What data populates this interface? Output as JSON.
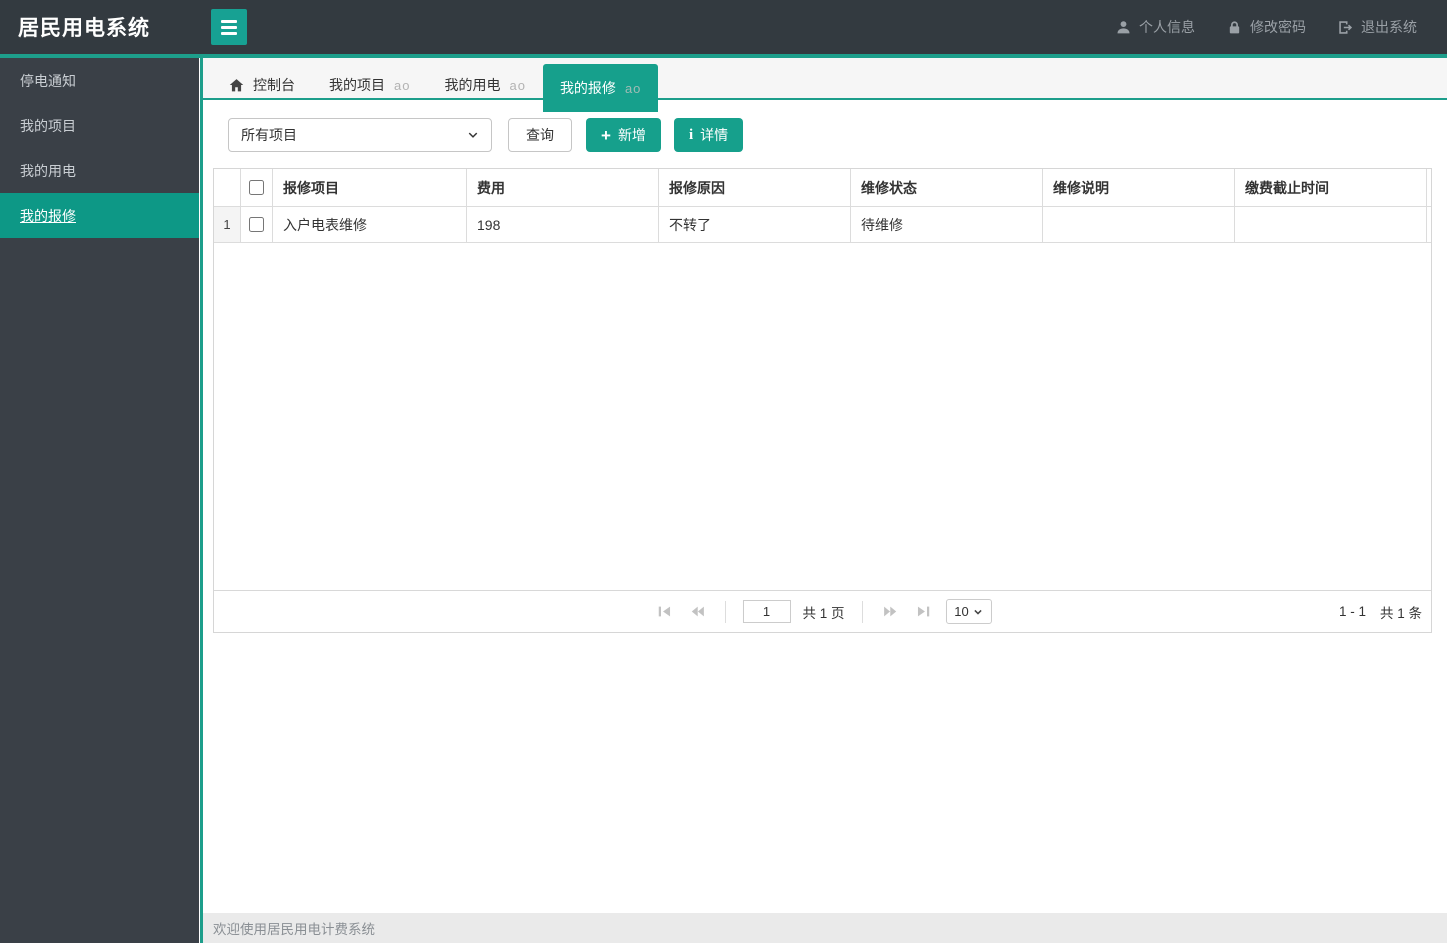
{
  "colors": {
    "accent": "#16a08c",
    "accent_line": "#1d9e8b",
    "header_bg": "#333a40",
    "sidebar_bg": "#3a4047",
    "sidebar_active_bg": "#0d9886",
    "tabbar_bg": "#f6f6f6",
    "statusbar_bg": "#eaeaea"
  },
  "app_title": "居民用电系统",
  "user_menu": {
    "profile": "个人信息",
    "password": "修改密码",
    "logout": "退出系统"
  },
  "sidebar": {
    "items": [
      {
        "label": "停电通知"
      },
      {
        "label": "我的项目"
      },
      {
        "label": "我的用电"
      },
      {
        "label": "我的报修"
      }
    ],
    "active_index": 3
  },
  "tabs": {
    "close_glyph": "ao",
    "items": [
      {
        "label": "控制台"
      },
      {
        "label": "我的项目"
      },
      {
        "label": "我的用电"
      },
      {
        "label": "我的报修"
      }
    ],
    "active_index": 3
  },
  "toolbar": {
    "project_select_value": "所有项目",
    "query_label": "查询",
    "add_label": "新增",
    "detail_label": "详情"
  },
  "grid": {
    "columns": [
      "报修项目",
      "费用",
      "报修原因",
      "维修状态",
      "维修说明",
      "缴费截止时间"
    ],
    "rows": [
      {
        "num": "1",
        "repair_item": "入户电表维修",
        "cost": "198",
        "reason": "不转了",
        "status": "待维修",
        "note": "",
        "deadline": ""
      }
    ]
  },
  "pager": {
    "page_value": "1",
    "total_pages": "共 1 页",
    "page_size": "10",
    "range": "1 - 1",
    "total_records": "共 1 条"
  },
  "statusbar": {
    "text": "欢迎使用居民用电计费系统"
  }
}
